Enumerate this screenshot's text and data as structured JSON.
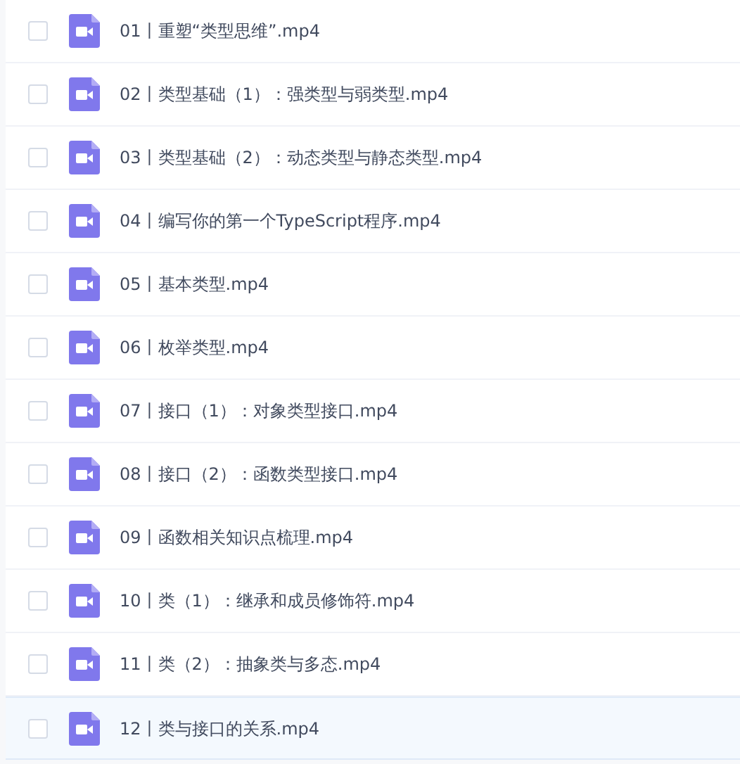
{
  "files": [
    {
      "name": "01丨重塑“类型思维”.mp4",
      "checked": false,
      "highlighted": false
    },
    {
      "name": "02丨类型基础（1）：强类型与弱类型.mp4",
      "checked": false,
      "highlighted": false
    },
    {
      "name": "03丨类型基础（2）：动态类型与静态类型.mp4",
      "checked": false,
      "highlighted": false
    },
    {
      "name": "04丨编写你的第一个TypeScript程序.mp4",
      "checked": false,
      "highlighted": false
    },
    {
      "name": "05丨基本类型.mp4",
      "checked": false,
      "highlighted": false
    },
    {
      "name": "06丨枚举类型.mp4",
      "checked": false,
      "highlighted": false
    },
    {
      "name": "07丨接口（1）：对象类型接口.mp4",
      "checked": false,
      "highlighted": false
    },
    {
      "name": "08丨接口（2）：函数类型接口.mp4",
      "checked": false,
      "highlighted": false
    },
    {
      "name": "09丨函数相关知识点梳理.mp4",
      "checked": false,
      "highlighted": false
    },
    {
      "name": "10丨类（1）：继承和成员修饰符.mp4",
      "checked": false,
      "highlighted": false
    },
    {
      "name": "11丨类（2）：抽象类与多态.mp4",
      "checked": false,
      "highlighted": false
    },
    {
      "name": "12丨类与接口的关系.mp4",
      "checked": false,
      "highlighted": true
    }
  ]
}
